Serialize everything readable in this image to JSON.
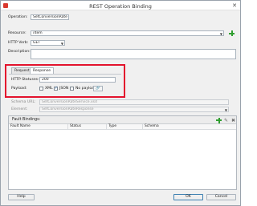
{
  "window": {
    "title": "REST Operation Binding",
    "close_glyph": "✕"
  },
  "form": {
    "operation": {
      "label": "Operation:",
      "value": "SetConversionRate"
    },
    "resource": {
      "label": "Resource:",
      "value": "/item"
    },
    "http_verb": {
      "label": "HTTP Verb:",
      "value": "GET"
    },
    "description": {
      "label": "Description:",
      "value": ""
    }
  },
  "tabs": [
    {
      "label": "Request",
      "active": false
    },
    {
      "label": "Response",
      "active": true
    }
  ],
  "response": {
    "http_statuses": {
      "label": "HTTP Statuses:",
      "value": "200"
    },
    "payload": {
      "label": "Payload:",
      "options": [
        {
          "label": "XML",
          "checked": false
        },
        {
          "label": "JSON",
          "checked": true
        },
        {
          "label": "No payload",
          "checked": false
        }
      ],
      "button_glyph": "🔗"
    }
  },
  "disabled_rows": [
    {
      "label": "Schema URL:",
      "value": "SetConversionRateService.xsd"
    },
    {
      "label": "Element:",
      "value": "SetConversionRateResponse"
    }
  ],
  "fault_bindings": {
    "title": "Fault Bindings:",
    "columns": [
      "Fault Name",
      "Status",
      "Type",
      "Schema"
    ],
    "rows": [],
    "edit_glyph": "✎",
    "delete_glyph": "✖"
  },
  "footer": {
    "help_label": "Help",
    "ok_label": "OK",
    "cancel_label": "Cancel"
  }
}
